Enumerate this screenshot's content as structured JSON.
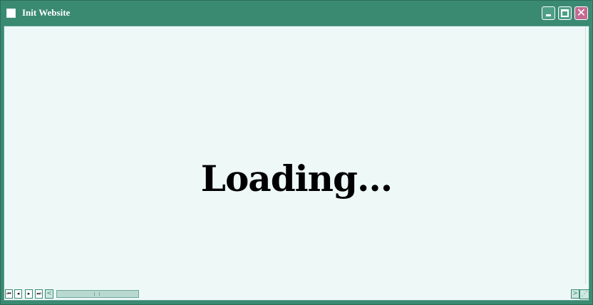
{
  "window": {
    "title": "Init Website",
    "controls": {
      "minimize_icon": "minimize-icon",
      "maximize_icon": "maximize-icon",
      "close_icon": "close-icon",
      "close_glyph": "✕"
    }
  },
  "content": {
    "message": "Loading..."
  },
  "statusbar": {
    "nav": {
      "first": "⏮",
      "prev": "◂",
      "next": "▸",
      "last": "⏭"
    },
    "scroll_left": "<",
    "scroll_right": ">",
    "resize": "⋰"
  },
  "colors": {
    "frame": "#3a8a72",
    "content_bg": "#eef9f7",
    "close_button": "#c46a92"
  }
}
